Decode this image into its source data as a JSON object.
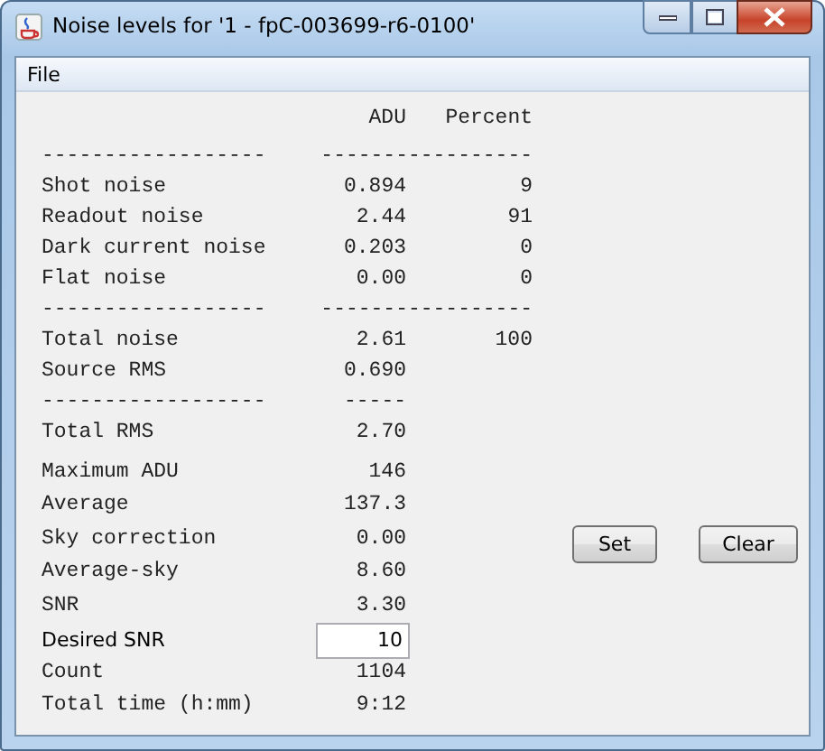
{
  "window": {
    "title": "Noise levels for '1 - fpC-003699-r6-0100'"
  },
  "menu": [
    "File"
  ],
  "header": {
    "adu": "ADU",
    "percent": "Percent"
  },
  "sections": [
    [
      {
        "kind": "rule",
        "label": "------------------",
        "span": "-----------------"
      },
      {
        "kind": "value",
        "label": "Shot noise",
        "adu": "0.894",
        "percent": "9"
      },
      {
        "kind": "value",
        "label": "Readout noise",
        "adu": "2.44",
        "percent": "91"
      },
      {
        "kind": "value",
        "label": "Dark current noise",
        "adu": "0.203",
        "percent": "0"
      },
      {
        "kind": "value",
        "label": "Flat noise",
        "adu": "0.00",
        "percent": "0"
      },
      {
        "kind": "rule",
        "label": "------------------",
        "span": "-----------------"
      },
      {
        "kind": "value",
        "label": "Total noise",
        "adu": "2.61",
        "percent": "100"
      },
      {
        "kind": "value",
        "label": "Source RMS",
        "adu": "0.690"
      },
      {
        "kind": "rule",
        "label": "------------------",
        "adu": "-----"
      },
      {
        "kind": "value",
        "label": "Total RMS",
        "adu": "2.70"
      }
    ],
    [
      {
        "kind": "value",
        "label": "Maximum ADU",
        "adu": "146"
      },
      {
        "kind": "value",
        "label": "Average",
        "adu": "137.3"
      },
      {
        "kind": "value",
        "label": "Sky correction",
        "adu": "0.00"
      },
      {
        "kind": "value",
        "label": "Average-sky",
        "adu": "8.60"
      },
      {
        "kind": "value",
        "label": "SNR",
        "adu": "3.30"
      },
      {
        "kind": "input",
        "label": "Desired SNR",
        "value": "10"
      },
      {
        "kind": "value",
        "label": "Count",
        "adu": "1104"
      },
      {
        "kind": "value",
        "label": "Total time (h:mm)",
        "adu": "9:12"
      }
    ]
  ],
  "buttons": [
    "Set",
    "Clear"
  ]
}
